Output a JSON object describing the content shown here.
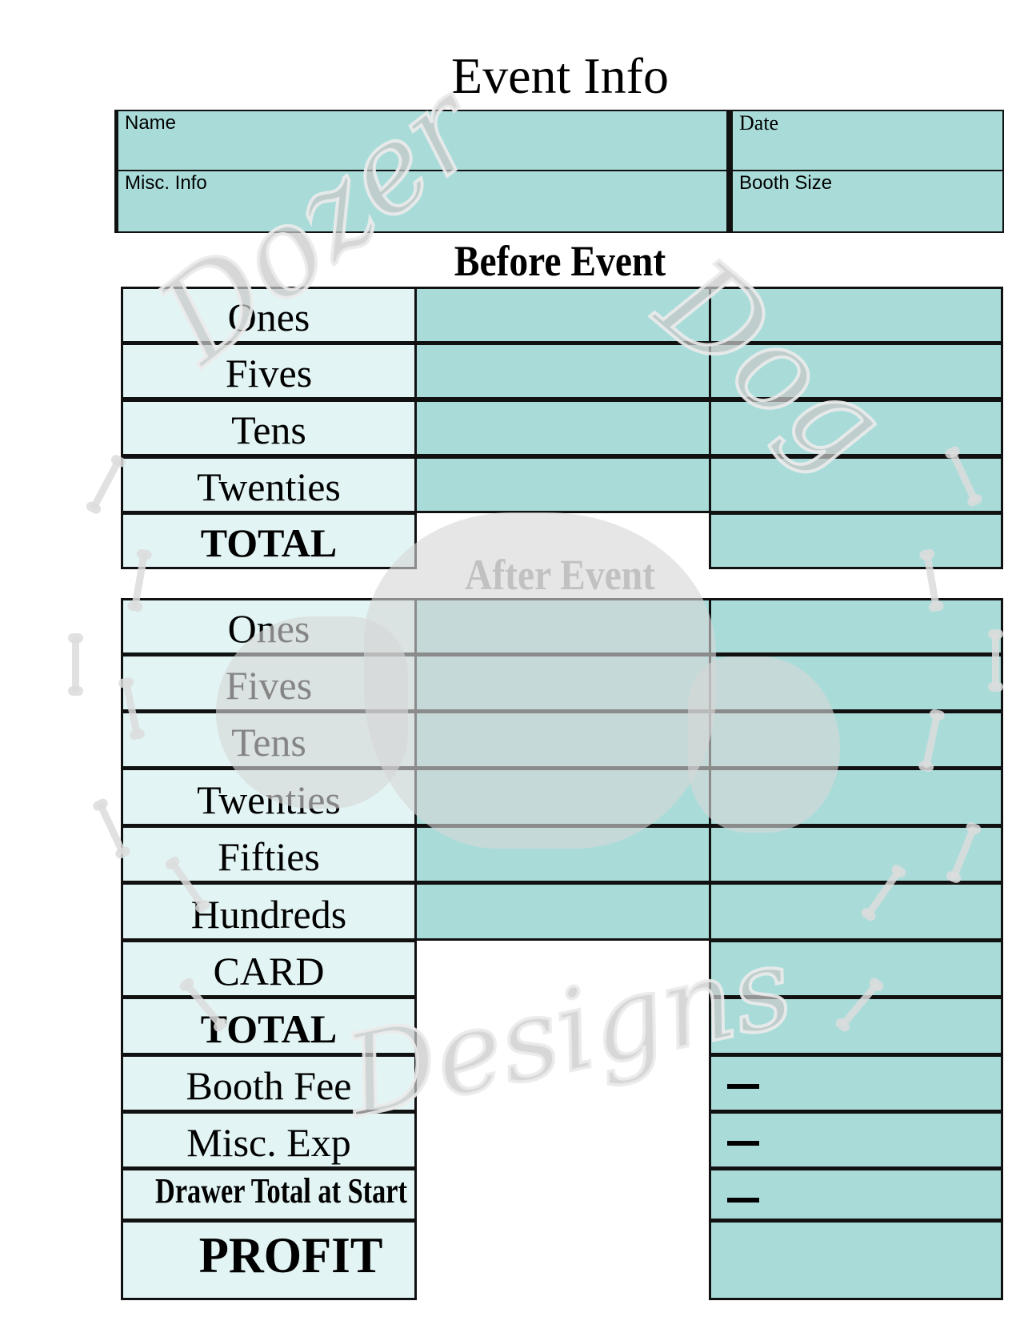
{
  "title": "Event Info",
  "event_info": {
    "name_label": "Name",
    "date_label": "Date",
    "misc_info_label": "Misc. Info",
    "booth_size_label": "Booth Size"
  },
  "before_event": {
    "heading": "Before Event",
    "rows": [
      {
        "label": "Ones"
      },
      {
        "label": "Fives"
      },
      {
        "label": "Tens"
      },
      {
        "label": "Twenties"
      },
      {
        "label": "TOTAL"
      }
    ]
  },
  "after_event": {
    "heading": "After Event",
    "rows": [
      {
        "label": "Ones"
      },
      {
        "label": "Fives"
      },
      {
        "label": "Tens"
      },
      {
        "label": "Twenties"
      },
      {
        "label": "Fifties"
      },
      {
        "label": "Hundreds"
      },
      {
        "label": "CARD"
      },
      {
        "label": "TOTAL"
      },
      {
        "label": "Booth Fee",
        "operator": "minus"
      },
      {
        "label": "Misc. Exp",
        "operator": "minus"
      },
      {
        "label": "Drawer Total at Start",
        "operator": "minus"
      },
      {
        "label": "PROFIT"
      }
    ]
  },
  "watermark": {
    "words": [
      "Dozer",
      "Dog",
      "Designs"
    ]
  },
  "colors": {
    "field_teal": "#a9dcd9",
    "label_pale": "#e3f4f4",
    "border": "#111111"
  }
}
